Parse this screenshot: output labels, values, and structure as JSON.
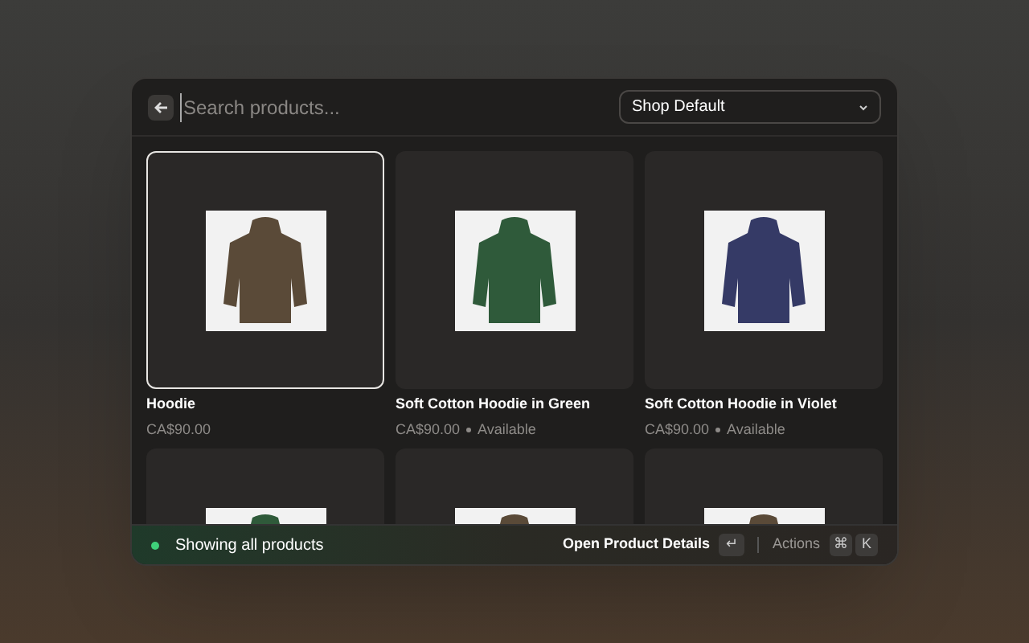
{
  "search": {
    "placeholder": "Search products..."
  },
  "shop_select": {
    "value": "Shop Default"
  },
  "products": [
    {
      "name": "Hoodie",
      "price": "CA$90.00",
      "color": "#5a4a38",
      "selected": true
    },
    {
      "name": "Soft Cotton Hoodie in Green",
      "price": "CA$90.00",
      "availability": "Available",
      "color": "#2f5a3a",
      "selected": false
    },
    {
      "name": "Soft Cotton Hoodie in Violet",
      "price": "CA$90.00",
      "availability": "Available",
      "color": "#353a66",
      "selected": false
    },
    {
      "color": "#2f5a3a",
      "selected": false
    },
    {
      "color": "#5a4a38",
      "selected": false
    },
    {
      "color": "#5a4a38",
      "selected": false
    }
  ],
  "status_bar": {
    "message": "Showing all products",
    "action": "Open Product Details",
    "enter_key": "↵",
    "actions_label": "Actions",
    "keys": [
      "⌘",
      "K"
    ]
  }
}
